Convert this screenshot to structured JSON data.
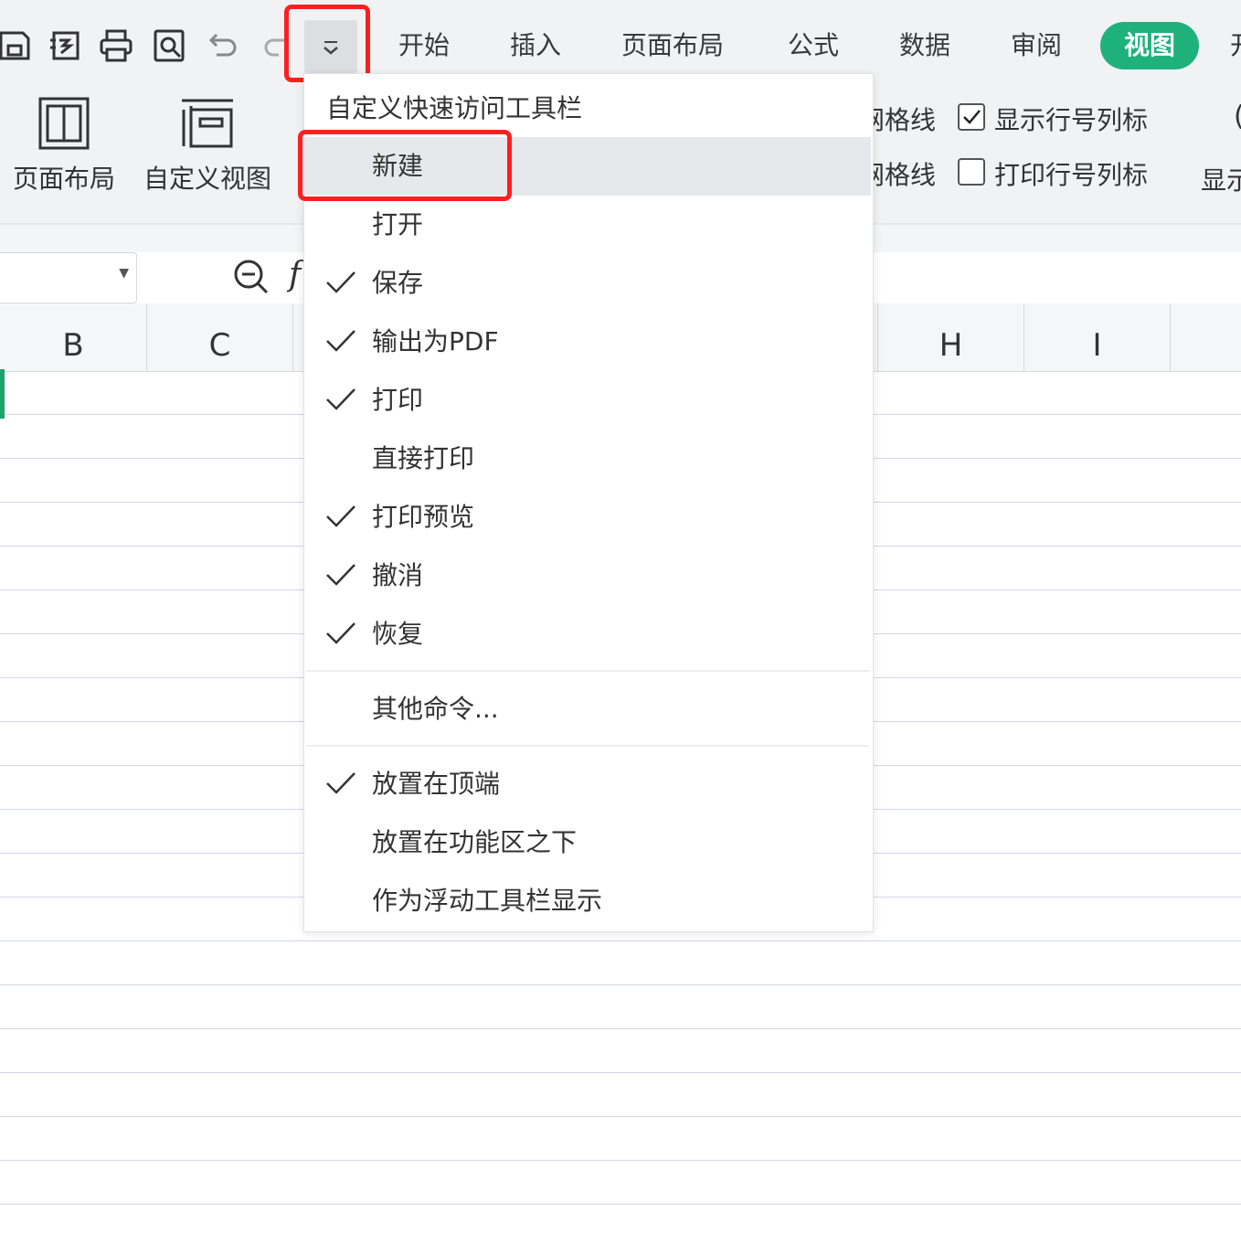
{
  "quick_access": {
    "icons": [
      "save-icon",
      "save-as-icon",
      "print-icon",
      "print-preview-icon",
      "undo-icon",
      "redo-icon"
    ],
    "dropdown_icon": "chevron-down-icon"
  },
  "tabs": {
    "start": "开始",
    "insert": "插入",
    "page_layout": "页面布局",
    "formula": "公式",
    "data": "数据",
    "review": "审阅",
    "view": "视图",
    "cut_off": "开"
  },
  "ribbon": {
    "page_layout_btn": "页面布局",
    "custom_view_btn": "自定义视图",
    "gridline_1": "网格线",
    "gridline_2": "网格线",
    "show_row_col_headers": "显示行号列标",
    "print_row_col_headers": "打印行号列标",
    "show_cut": "显示",
    "show_row_col_checked": true,
    "print_row_col_checked": false
  },
  "formula_bar": {
    "fx_symbol": "f"
  },
  "columns": {
    "b": "B",
    "c": "C",
    "h": "H",
    "i": "I"
  },
  "menu": {
    "title": "自定义快速访问工具栏",
    "items": [
      {
        "label": "新建",
        "checked": false
      },
      {
        "label": "打开",
        "checked": false
      },
      {
        "label": "保存",
        "checked": true
      },
      {
        "label": "输出为PDF",
        "checked": true
      },
      {
        "label": "打印",
        "checked": true
      },
      {
        "label": "直接打印",
        "checked": false
      },
      {
        "label": "打印预览",
        "checked": true
      },
      {
        "label": "撤消",
        "checked": true
      },
      {
        "label": "恢复",
        "checked": true
      },
      {
        "label": "其他命令...",
        "checked": false
      },
      {
        "label": "放置在顶端",
        "checked": true
      },
      {
        "label": "放置在功能区之下",
        "checked": false
      },
      {
        "label": "作为浮动工具栏显示",
        "checked": false
      }
    ]
  },
  "colors": {
    "accent_green": "#1fb17c",
    "highlight_red": "#ff1f1f"
  }
}
